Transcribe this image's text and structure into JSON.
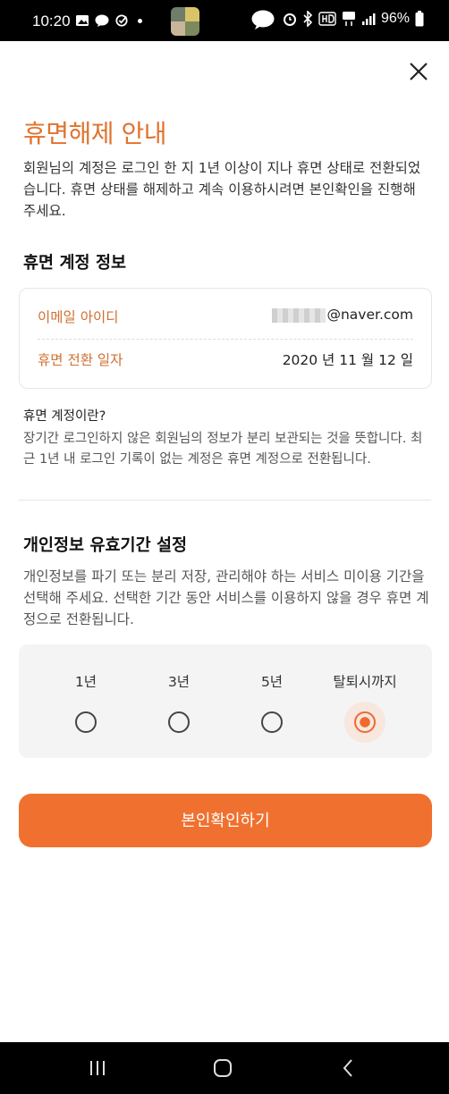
{
  "status_bar": {
    "time": "10:20",
    "battery": "96%"
  },
  "dialog": {
    "title": "휴면해제 안내",
    "intro": "회원님의 계정은 로그인 한 지 1년 이상이 지나 휴면 상태로 전환되었습니다. 휴면 상태를 해제하고 계속 이용하시려면 본인확인을 진행해 주세요.",
    "account_section_title": "휴면 계정 정보",
    "account_info": {
      "email_label": "이메일 아이디",
      "email_value": "@naver.com",
      "date_label": "휴면 전환 일자",
      "date_value": "2020 년 11 월 12 일"
    },
    "dormant_question": "휴면 계정이란?",
    "dormant_description": "장기간 로그인하지 않은 회원님의 정보가 분리 보관되는 것을 뜻합니다. 최근 1년 내 로그인 기록이 없는 계정은 휴면 계정으로 전환됩니다.",
    "period_section_title": "개인정보 유효기간 설정",
    "period_description": "개인정보를 파기 또는 분리 저장, 관리해야 하는 서비스 미이용 기간을 선택해 주세요. 선택한 기간 동안 서비스를 이용하지 않을 경우 휴면 계정으로 전환됩니다.",
    "period_options": [
      {
        "label": "1년",
        "selected": false
      },
      {
        "label": "3년",
        "selected": false
      },
      {
        "label": "5년",
        "selected": false
      },
      {
        "label": "탈퇴시까지",
        "selected": true
      }
    ],
    "confirm_button": "본인확인하기"
  },
  "colors": {
    "accent": "#f0712f",
    "title": "#e0722e",
    "label": "#d07033"
  }
}
